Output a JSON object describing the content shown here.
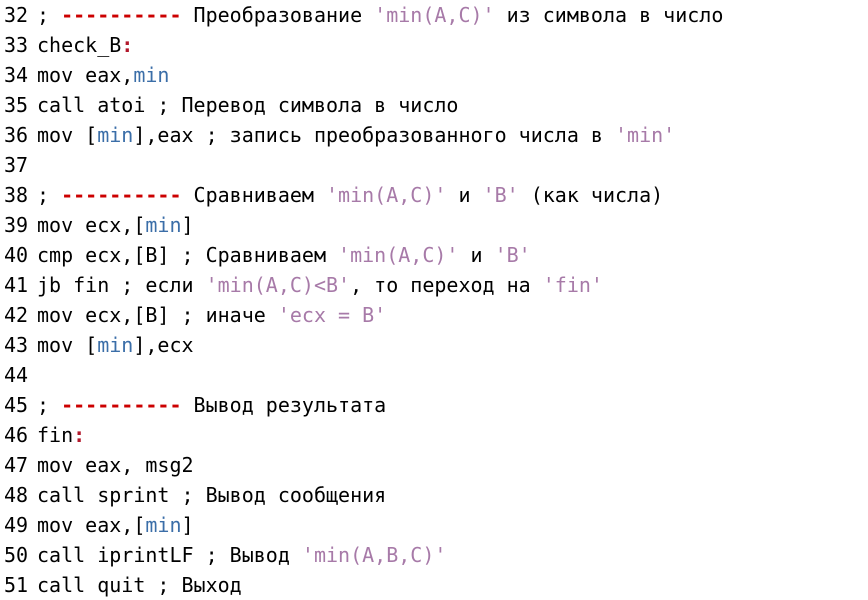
{
  "colors": {
    "background": "#ffffff",
    "text": "#000000",
    "dash": "#cc0000",
    "string": "#a77aa8",
    "identifier": "#3b6ea8",
    "label_colon": "#b2182b"
  },
  "lines": [
    {
      "num": "32",
      "tokens": [
        {
          "t": "comment",
          "v": "; "
        },
        {
          "t": "dash",
          "v": "----------"
        },
        {
          "t": "comment",
          "v": " Преобразование "
        },
        {
          "t": "string",
          "v": "'min(A,C)'"
        },
        {
          "t": "comment",
          "v": " из символа в число"
        }
      ]
    },
    {
      "num": "33",
      "tokens": [
        {
          "t": "label",
          "v": "check_B"
        },
        {
          "t": "colon",
          "v": ":"
        }
      ]
    },
    {
      "num": "34",
      "tokens": [
        {
          "t": "plain",
          "v": "mov eax,"
        },
        {
          "t": "ident",
          "v": "min"
        }
      ]
    },
    {
      "num": "35",
      "tokens": [
        {
          "t": "plain",
          "v": "call atoi ; Перевод символа в число"
        }
      ]
    },
    {
      "num": "36",
      "tokens": [
        {
          "t": "plain",
          "v": "mov ["
        },
        {
          "t": "ident",
          "v": "min"
        },
        {
          "t": "plain",
          "v": "],eax ; запись преобразованного числа в "
        },
        {
          "t": "string",
          "v": "'min'"
        }
      ]
    },
    {
      "num": "37",
      "tokens": []
    },
    {
      "num": "38",
      "tokens": [
        {
          "t": "comment",
          "v": "; "
        },
        {
          "t": "dash",
          "v": "----------"
        },
        {
          "t": "comment",
          "v": " Сравниваем "
        },
        {
          "t": "string",
          "v": "'min(A,C)'"
        },
        {
          "t": "comment",
          "v": " и "
        },
        {
          "t": "string",
          "v": "'B'"
        },
        {
          "t": "comment",
          "v": " (как числа)"
        }
      ]
    },
    {
      "num": "39",
      "tokens": [
        {
          "t": "plain",
          "v": "mov ecx,["
        },
        {
          "t": "ident",
          "v": "min"
        },
        {
          "t": "plain",
          "v": "]"
        }
      ]
    },
    {
      "num": "40",
      "tokens": [
        {
          "t": "plain",
          "v": "cmp ecx,[B] ; Сравниваем "
        },
        {
          "t": "string",
          "v": "'min(A,C)'"
        },
        {
          "t": "plain",
          "v": " и "
        },
        {
          "t": "string",
          "v": "'B'"
        }
      ]
    },
    {
      "num": "41",
      "tokens": [
        {
          "t": "plain",
          "v": "jb fin ; если "
        },
        {
          "t": "string",
          "v": "'min(A,C)<B'"
        },
        {
          "t": "plain",
          "v": ", то переход на "
        },
        {
          "t": "string",
          "v": "'fin'"
        }
      ]
    },
    {
      "num": "42",
      "tokens": [
        {
          "t": "plain",
          "v": "mov ecx,[B] ; иначе "
        },
        {
          "t": "string",
          "v": "'ecx = B'"
        }
      ]
    },
    {
      "num": "43",
      "tokens": [
        {
          "t": "plain",
          "v": "mov ["
        },
        {
          "t": "ident",
          "v": "min"
        },
        {
          "t": "plain",
          "v": "],ecx"
        }
      ]
    },
    {
      "num": "44",
      "tokens": []
    },
    {
      "num": "45",
      "tokens": [
        {
          "t": "comment",
          "v": "; "
        },
        {
          "t": "dash",
          "v": "----------"
        },
        {
          "t": "comment",
          "v": " Вывод результата"
        }
      ]
    },
    {
      "num": "46",
      "tokens": [
        {
          "t": "label",
          "v": "fin"
        },
        {
          "t": "colon",
          "v": ":"
        }
      ]
    },
    {
      "num": "47",
      "tokens": [
        {
          "t": "plain",
          "v": "mov eax, msg2"
        }
      ]
    },
    {
      "num": "48",
      "tokens": [
        {
          "t": "plain",
          "v": "call sprint ; Вывод сообщения"
        }
      ]
    },
    {
      "num": "49",
      "tokens": [
        {
          "t": "plain",
          "v": "mov eax,["
        },
        {
          "t": "ident",
          "v": "min"
        },
        {
          "t": "plain",
          "v": "]"
        }
      ]
    },
    {
      "num": "50",
      "tokens": [
        {
          "t": "plain",
          "v": "call iprintLF ; Вывод "
        },
        {
          "t": "string",
          "v": "'min(A,B,C)'"
        }
      ]
    },
    {
      "num": "51",
      "tokens": [
        {
          "t": "plain",
          "v": "call quit ; Выход"
        }
      ]
    }
  ]
}
